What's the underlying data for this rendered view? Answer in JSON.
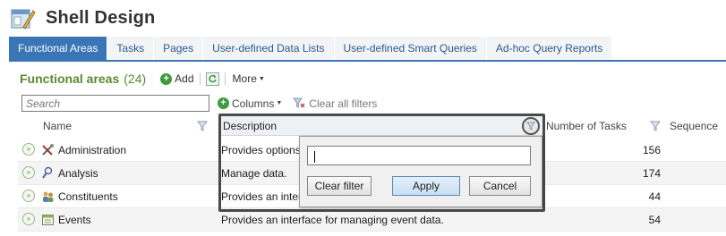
{
  "app": {
    "title": "Shell Design",
    "icon": "shell-design-icon"
  },
  "tabs": [
    {
      "label": "Functional Areas",
      "active": true
    },
    {
      "label": "Tasks"
    },
    {
      "label": "Pages"
    },
    {
      "label": "User-defined Data Lists"
    },
    {
      "label": "User-defined Smart Queries"
    },
    {
      "label": "Ad-hoc Query Reports"
    }
  ],
  "panel": {
    "title": "Functional areas",
    "count": "(24)",
    "add_label": "Add",
    "more_label": "More",
    "search_placeholder": "Search",
    "columns_label": "Columns",
    "clear_filters_label": "Clear all filters"
  },
  "grid": {
    "headers": {
      "name": "Name",
      "description": "Description",
      "tasks": "Number of Tasks",
      "sequence": "Sequence"
    },
    "rows": [
      {
        "name": "Administration",
        "icon": "tools-icon",
        "description": "Provides options",
        "tasks": "156"
      },
      {
        "name": "Analysis",
        "icon": "analysis-icon",
        "description": "Manage data.",
        "tasks": "174"
      },
      {
        "name": "Constituents",
        "icon": "people-icon",
        "description": "Provides an inter",
        "tasks": "44"
      },
      {
        "name": "Events",
        "icon": "calendar-icon",
        "description": "Provides an interface for managing event data.",
        "tasks": "54"
      }
    ]
  },
  "filter_popup": {
    "value": "",
    "clear_label": "Clear filter",
    "apply_label": "Apply",
    "cancel_label": "Cancel"
  },
  "colors": {
    "accent": "#3a76b6",
    "title_green": "#5a8a2f",
    "frame": "#4a4a4a"
  }
}
